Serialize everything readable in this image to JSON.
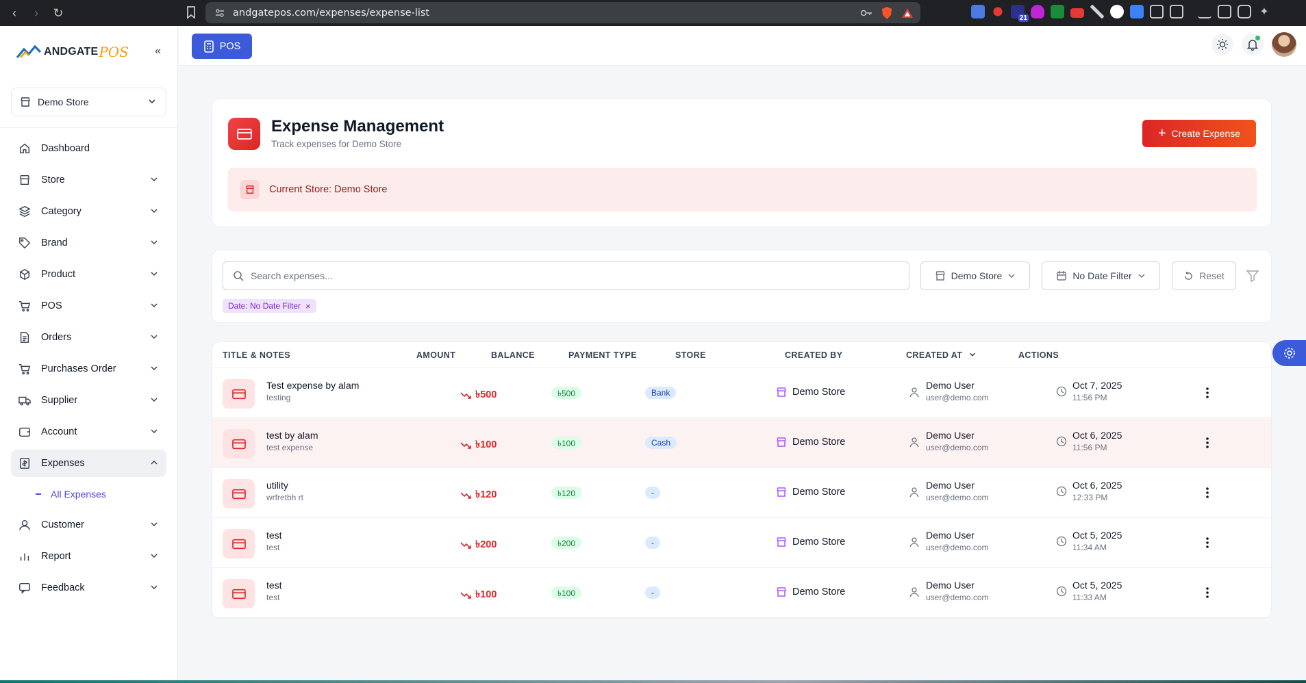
{
  "browser": {
    "url": "andgatepos.com/expenses/expense-list",
    "ext_badge": "21"
  },
  "sidebar": {
    "logo_text": "ANDGATE",
    "logo_pos": "POS",
    "store_select": "Demo Store",
    "items": [
      {
        "label": "Dashboard",
        "icon": "home-icon",
        "has_chevron": false
      },
      {
        "label": "Store",
        "icon": "store-icon",
        "has_chevron": true
      },
      {
        "label": "Category",
        "icon": "layers-icon",
        "has_chevron": true
      },
      {
        "label": "Brand",
        "icon": "tag-icon",
        "has_chevron": true
      },
      {
        "label": "Product",
        "icon": "box-icon",
        "has_chevron": true
      },
      {
        "label": "POS",
        "icon": "cart-icon",
        "has_chevron": true
      },
      {
        "label": "Orders",
        "icon": "file-icon",
        "has_chevron": true
      },
      {
        "label": "Purchases Order",
        "icon": "cart-icon",
        "has_chevron": true
      },
      {
        "label": "Supplier",
        "icon": "truck-icon",
        "has_chevron": true
      },
      {
        "label": "Account",
        "icon": "wallet-icon",
        "has_chevron": true
      },
      {
        "label": "Expenses",
        "icon": "receipt-icon",
        "has_chevron": true,
        "expanded": true
      },
      {
        "label": "Customer",
        "icon": "user-icon",
        "has_chevron": true
      },
      {
        "label": "Report",
        "icon": "bar-chart-icon",
        "has_chevron": true
      },
      {
        "label": "Feedback",
        "icon": "feedback-icon",
        "has_chevron": true
      }
    ],
    "sub_item": "All Expenses"
  },
  "topbar": {
    "pos_label": "POS"
  },
  "header": {
    "title": "Expense Management",
    "subtitle": "Track expenses for Demo Store",
    "create_label": "Create Expense",
    "banner": "Current Store: Demo Store"
  },
  "filters": {
    "search_placeholder": "Search expenses...",
    "store": "Demo Store",
    "date": "No Date Filter",
    "reset": "Reset",
    "chip": "Date: No Date Filter"
  },
  "table": {
    "columns": [
      "TITLE & NOTES",
      "AMOUNT",
      "BALANCE",
      "PAYMENT TYPE",
      "STORE",
      "CREATED BY",
      "CREATED AT",
      "ACTIONS"
    ],
    "rows": [
      {
        "title": "Test expense by alam",
        "note": "testing",
        "amount": "৳500",
        "balance": "৳500",
        "payment": "Bank",
        "store": "Demo Store",
        "user": "Demo User",
        "email": "user@demo.com",
        "date": "Oct 7, 2025",
        "time": "11:56 PM"
      },
      {
        "title": "test by alam",
        "note": "test expense",
        "amount": "৳100",
        "balance": "৳100",
        "payment": "Cash",
        "store": "Demo Store",
        "user": "Demo User",
        "email": "user@demo.com",
        "date": "Oct 6, 2025",
        "time": "11:56 PM"
      },
      {
        "title": "utility",
        "note": "wrfretbh rt",
        "amount": "৳120",
        "balance": "৳120",
        "payment": "-",
        "store": "Demo Store",
        "user": "Demo User",
        "email": "user@demo.com",
        "date": "Oct 6, 2025",
        "time": "12:33 PM"
      },
      {
        "title": "test",
        "note": "test",
        "amount": "৳200",
        "balance": "৳200",
        "payment": "-",
        "store": "Demo Store",
        "user": "Demo User",
        "email": "user@demo.com",
        "date": "Oct 5, 2025",
        "time": "11:34 AM"
      },
      {
        "title": "test",
        "note": "test",
        "amount": "৳100",
        "balance": "৳100",
        "payment": "-",
        "store": "Demo Store",
        "user": "Demo User",
        "email": "user@demo.com",
        "date": "Oct 5, 2025",
        "time": "11:33 AM"
      }
    ]
  },
  "colors": {
    "accent": "#3b5bdb",
    "danger": "#dc2626",
    "success": "#15803d"
  }
}
